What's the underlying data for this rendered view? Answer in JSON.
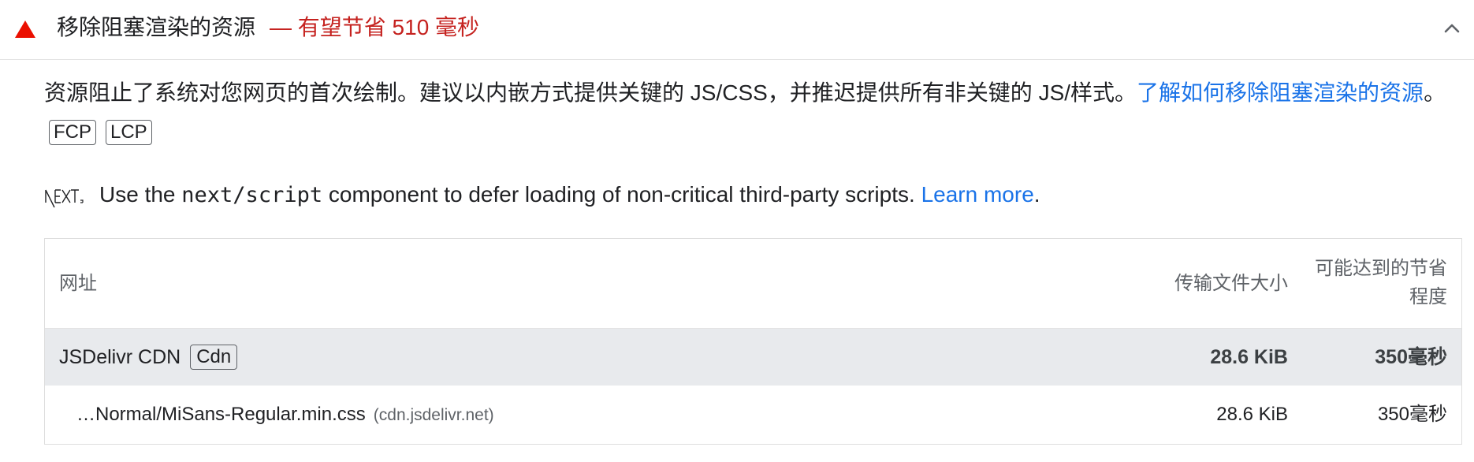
{
  "audit": {
    "title": "移除阻塞渲染的资源",
    "savings": "— 有望节省 510 毫秒",
    "icons": {
      "status": "warning-triangle-icon",
      "collapse": "chevron-up-icon"
    },
    "colors": {
      "warning": "#eb0f00",
      "savings_text": "#c5221f",
      "link": "#1a73e8",
      "group_row_bg": "#e8eaed"
    }
  },
  "description": {
    "text": "资源阻止了系统对您网页的首次绘制。建议以内嵌方式提供关键的 JS/CSS，并推迟提供所有非关键的 JS/样式。",
    "link_text": "了解如何移除阻塞渲染的资源",
    "suffix": "。",
    "metrics": [
      "FCP",
      "LCP"
    ]
  },
  "stack_pack": {
    "icon": "nextjs-logo-icon",
    "prefix": "Use the ",
    "code": "next/script",
    "suffix": " component to defer loading of non-critical third-party scripts. ",
    "link_text": "Learn more",
    "end": "."
  },
  "table": {
    "headers": {
      "url": "网址",
      "size": "传输文件大小",
      "savings": "可能达到的节省程度"
    },
    "group": {
      "name": "JSDelivr CDN",
      "badge": "Cdn",
      "size": "28.6 KiB",
      "savings": "350毫秒"
    },
    "rows": [
      {
        "url": "…Normal/MiSans-Regular.min.css",
        "host": "(cdn.jsdelivr.net)",
        "size": "28.6 KiB",
        "savings": "350毫秒"
      }
    ]
  }
}
